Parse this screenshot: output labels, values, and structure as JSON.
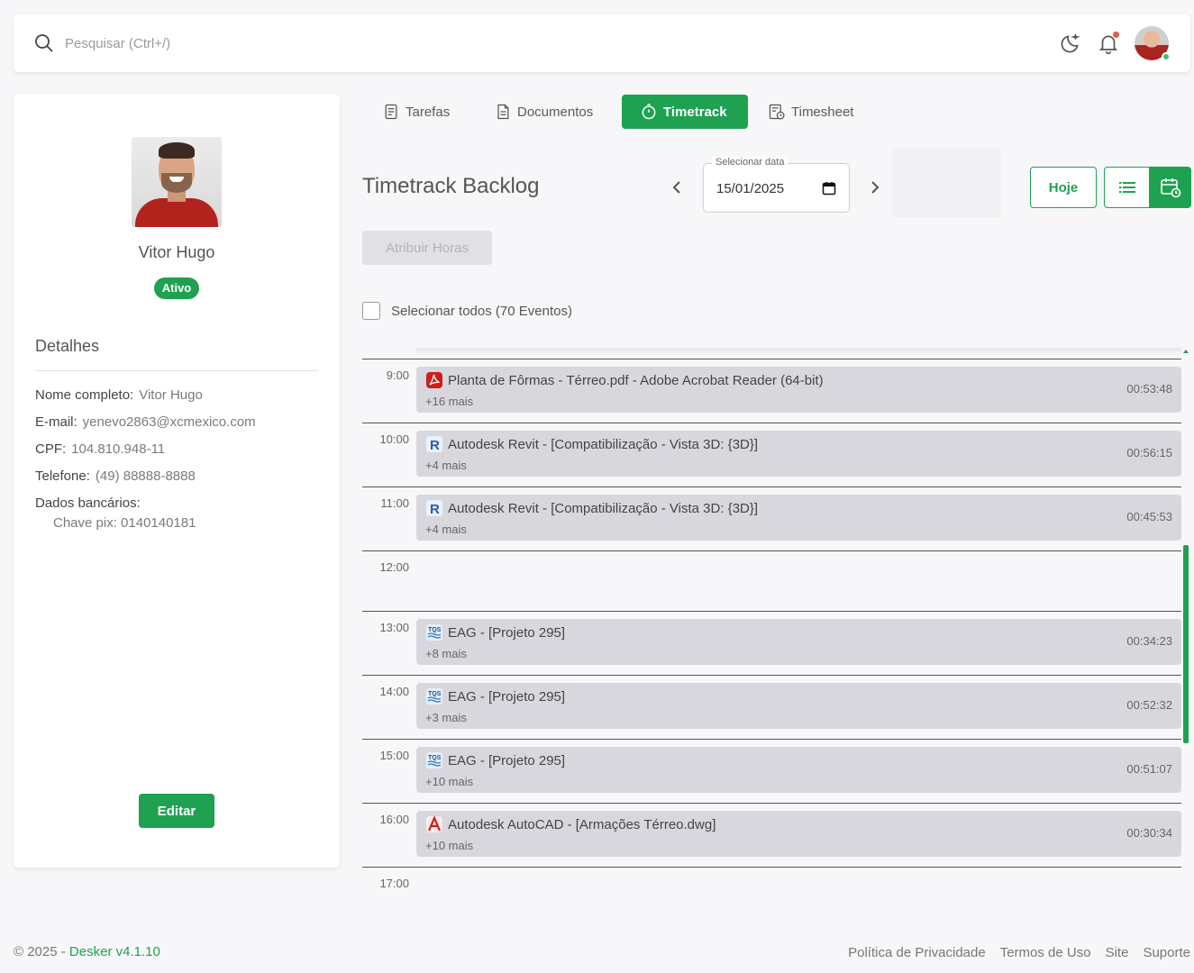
{
  "search": {
    "placeholder": "Pesquisar (Ctrl+/)"
  },
  "profile": {
    "name": "Vitor Hugo",
    "status": "Ativo",
    "details_title": "Detalhes",
    "details": [
      {
        "label": "Nome completo:",
        "value": "Vitor Hugo"
      },
      {
        "label": "E-mail:",
        "value": "yenevo2863@xcmexico.com"
      },
      {
        "label": "CPF:",
        "value": "104.810.948-11"
      },
      {
        "label": "Telefone:",
        "value": "(49) 88888-8888"
      },
      {
        "label": "Dados bancários:",
        "value": ""
      }
    ],
    "pix": "Chave pix: 0140140181",
    "edit_label": "Editar"
  },
  "tabs": [
    {
      "label": "Tarefas",
      "icon": "list-doc-icon"
    },
    {
      "label": "Documentos",
      "icon": "document-icon"
    },
    {
      "label": "Timetrack",
      "icon": "stopwatch-icon",
      "active": true
    },
    {
      "label": "Timesheet",
      "icon": "timesheet-icon"
    }
  ],
  "timetrack": {
    "title": "Timetrack Backlog",
    "date_label": "Selecionar data",
    "date_value": "15/01/2025",
    "today_label": "Hoje",
    "assign_label": "Atribuir Horas",
    "select_all_label": "Selecionar todos (70 Eventos)"
  },
  "timeline": {
    "hours": [
      "9:00",
      "10:00",
      "11:00",
      "12:00",
      "13:00",
      "14:00",
      "15:00",
      "16:00",
      "17:00"
    ],
    "events": [
      {
        "hour": "9:00",
        "app": "acrobat",
        "title": "Planta de Fôrmas - Térreo.pdf - Adobe Acrobat Reader (64-bit)",
        "more": "+16 mais",
        "duration": "00:53:48"
      },
      {
        "hour": "10:00",
        "app": "revit",
        "title": "Autodesk Revit  - [Compatibilização - Vista 3D: {3D}]",
        "more": "+4 mais",
        "duration": "00:56:15"
      },
      {
        "hour": "11:00",
        "app": "revit",
        "title": "Autodesk Revit  - [Compatibilização - Vista 3D: {3D}]",
        "more": "+4 mais",
        "duration": "00:45:53"
      },
      {
        "hour": "13:00",
        "app": "tqs",
        "title": "EAG - [Projeto 295]",
        "more": "+8 mais",
        "duration": "00:34:23"
      },
      {
        "hour": "14:00",
        "app": "tqs",
        "title": "EAG - [Projeto 295]",
        "more": "+3 mais",
        "duration": "00:52:32"
      },
      {
        "hour": "15:00",
        "app": "tqs",
        "title": "EAG - [Projeto 295]",
        "more": "+10 mais",
        "duration": "00:51:07"
      },
      {
        "hour": "16:00",
        "app": "autocad",
        "title": "Autodesk AutoCAD  - [Armações Térreo.dwg]",
        "more": "+10 mais",
        "duration": "00:30:34"
      }
    ]
  },
  "footer": {
    "copyright": "© 2025 - ",
    "brand": "Desker v4.1.10",
    "links": [
      "Política de Privacidade",
      "Termos de Uso",
      "Site",
      "Suporte"
    ]
  },
  "colors": {
    "accent": "#1fa152",
    "event_bg": "#d9d7de",
    "notification": "#e85a4f"
  }
}
